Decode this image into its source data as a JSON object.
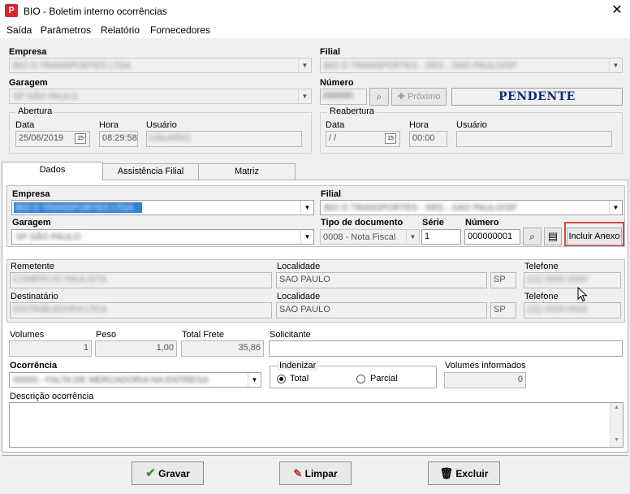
{
  "window": {
    "title": "BIO - Boletim interno ocorrências",
    "app_icon": "P",
    "close": "✕"
  },
  "menu": [
    "Saída",
    "Parâmetros",
    "Relatório",
    "Fornecedores"
  ],
  "header": {
    "empresa_label": "Empresa",
    "empresa_value": "BIO D TRANSPORTES LTDA",
    "filial_label": "Filial",
    "filial_value": "BIO D TRANSPORTES - SRS - SAO PAULO/SP",
    "garagem_label": "Garagem",
    "garagem_value": "SP SÃO PAULO",
    "numero_label": "Número",
    "numero_value": "000000",
    "proximo_label": "Próximo",
    "status": "PENDENTE",
    "abertura": {
      "title": "Abertura",
      "data_label": "Data",
      "data_value": "25/06/2019",
      "hora_label": "Hora",
      "hora_value": "08:29:58",
      "usuario_label": "Usuário",
      "usuario_value": "USUARIO"
    },
    "reabertura": {
      "title": "Reabertura",
      "data_label": "Data",
      "data_value": "/ /",
      "hora_label": "Hora",
      "hora_value": "00:00",
      "usuario_label": "Usuário",
      "usuario_value": ""
    }
  },
  "tabs": [
    "Dados",
    "Assistência Filial",
    "Matriz"
  ],
  "dados": {
    "empresa_label": "Empresa",
    "empresa_value": "BIO D TRANSPORTES LTDA",
    "filial_label": "Filial",
    "filial_value": "BIO D TRANSPORTES - SRS - SAO PAULO/SP",
    "garagem_label": "Garagem",
    "garagem_value": "SP SÃO PAULO",
    "tipo_doc_label": "Tipo de documento",
    "tipo_doc_value": "0008 - Nota Fiscal",
    "serie_label": "Série",
    "serie_value": "1",
    "numero_label": "Número",
    "numero_value": "000000001",
    "incluir_anexo": "Incluir Anexo",
    "remetente_label": "Remetente",
    "remetente_value": "COMERCIO PAULISTA",
    "localidade_label": "Localidade",
    "remetente_localidade": "SAO PAULO",
    "remetente_uf": "SP",
    "telefone_label": "Telefone",
    "remetente_telefone": "(11) 0000-0000",
    "destinatario_label": "Destinatário",
    "destinatario_value": "DISTRIBUIDORA LTDA",
    "destinatario_localidade": "SAO PAULO",
    "destinatario_uf": "SP",
    "destinatario_telefone": "(11) 0000-0000",
    "volumes_label": "Volumes",
    "volumes_value": "1",
    "peso_label": "Peso",
    "peso_value": "1,00",
    "total_frete_label": "Total Frete",
    "total_frete_value": "35,86",
    "solicitante_label": "Solicitante",
    "solicitante_value": "",
    "ocorrencia_label": "Ocorrência",
    "ocorrencia_value": "00000 - FALTA DE MERCADORIA NA ENTREGA",
    "indenizar_label": "Indenizar",
    "total_label": "Total",
    "parcial_label": "Parcial",
    "volumes_informados_label": "Volumes informados",
    "volumes_informados_value": "0",
    "descricao_label": "Descrição ocorrência",
    "descricao_value": ""
  },
  "buttons": {
    "gravar": "Gravar",
    "limpar": "Limpar",
    "excluir": "Excluir"
  }
}
